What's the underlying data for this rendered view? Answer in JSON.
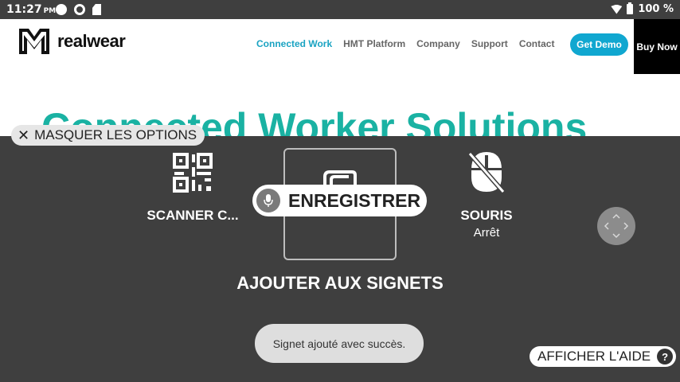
{
  "status_bar": {
    "time": "11:27",
    "ampm": "PM",
    "battery": "100 %"
  },
  "website": {
    "logo_text": "realwear",
    "nav": [
      "Connected Work",
      "HMT Platform",
      "Company",
      "Support",
      "Contact"
    ],
    "active_nav": "Connected Work",
    "get_demo": "Get Demo",
    "buy_now": "Buy Now",
    "hero_title": "Connected Worker Solutions",
    "accent_color": "#1aa3c2"
  },
  "overlay": {
    "hide_options": "MASQUER LES OPTIONS",
    "options": {
      "scanner": {
        "label": "SCANNER C...",
        "icon": "qr-code-icon"
      },
      "bookmark": {
        "label": "AJOUTER AUX SIGNETS",
        "icon": "bookmark-icon"
      },
      "mouse": {
        "label": "SOURIS",
        "state": "Arrêt",
        "icon": "mouse-off-icon"
      }
    },
    "record_label": "ENREGISTRER",
    "toast": "Signet ajouté avec succès.",
    "help": "AFFICHER L'AIDE",
    "help_icon": "?"
  }
}
